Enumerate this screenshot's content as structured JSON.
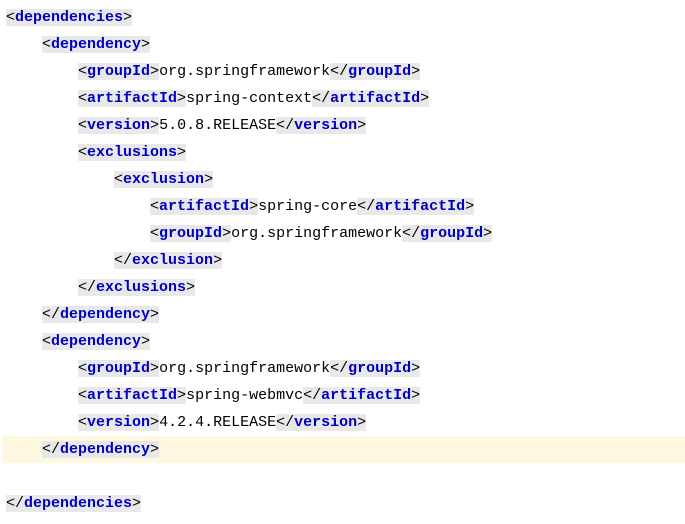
{
  "lines": [
    {
      "indent": 0,
      "parts": [
        {
          "t": "o",
          "v": "dependencies"
        }
      ],
      "sel": false,
      "hl": false
    },
    {
      "indent": 1,
      "parts": [
        {
          "t": "o",
          "v": "dependency"
        }
      ],
      "sel": false,
      "hl": false
    },
    {
      "indent": 2,
      "parts": [
        {
          "t": "o",
          "v": "groupId"
        },
        {
          "t": "x",
          "v": "org.springframework"
        },
        {
          "t": "c",
          "v": "groupId"
        }
      ],
      "sel": false,
      "hl": false
    },
    {
      "indent": 2,
      "parts": [
        {
          "t": "o",
          "v": "artifactId"
        },
        {
          "t": "x",
          "v": "spring-context"
        },
        {
          "t": "c",
          "v": "artifactId"
        }
      ],
      "sel": false,
      "hl": false
    },
    {
      "indent": 2,
      "parts": [
        {
          "t": "o",
          "v": "version"
        },
        {
          "t": "x",
          "v": "5.0.8.RELEASE"
        },
        {
          "t": "c",
          "v": "version"
        }
      ],
      "sel": false,
      "hl": false
    },
    {
      "indent": 2,
      "parts": [
        {
          "t": "o",
          "v": "exclusions"
        }
      ],
      "sel": false,
      "hl": false
    },
    {
      "indent": 3,
      "parts": [
        {
          "t": "o",
          "v": "exclusion"
        }
      ],
      "sel": false,
      "hl": false
    },
    {
      "indent": 4,
      "parts": [
        {
          "t": "o",
          "v": "artifactId"
        },
        {
          "t": "x",
          "v": "spring-core"
        },
        {
          "t": "c",
          "v": "artifactId"
        }
      ],
      "sel": false,
      "hl": false
    },
    {
      "indent": 4,
      "parts": [
        {
          "t": "o",
          "v": "groupId"
        },
        {
          "t": "x",
          "v": "org.springframework"
        },
        {
          "t": "c",
          "v": "groupId"
        }
      ],
      "sel": false,
      "hl": false
    },
    {
      "indent": 3,
      "parts": [
        {
          "t": "c",
          "v": "exclusion"
        }
      ],
      "sel": false,
      "hl": false
    },
    {
      "indent": 2,
      "parts": [
        {
          "t": "c",
          "v": "exclusions"
        }
      ],
      "sel": false,
      "hl": false
    },
    {
      "indent": 1,
      "parts": [
        {
          "t": "c",
          "v": "dependency"
        }
      ],
      "sel": false,
      "hl": false
    },
    {
      "indent": 1,
      "parts": [
        {
          "t": "o",
          "v": "dependency"
        }
      ],
      "sel": true,
      "hl": false
    },
    {
      "indent": 2,
      "parts": [
        {
          "t": "o",
          "v": "groupId"
        },
        {
          "t": "x",
          "v": "org.springframework"
        },
        {
          "t": "c",
          "v": "groupId"
        }
      ],
      "sel": false,
      "hl": false
    },
    {
      "indent": 2,
      "parts": [
        {
          "t": "o",
          "v": "artifactId"
        },
        {
          "t": "x",
          "v": "spring-webmvc"
        },
        {
          "t": "c",
          "v": "artifactId"
        }
      ],
      "sel": false,
      "hl": false
    },
    {
      "indent": 2,
      "parts": [
        {
          "t": "o",
          "v": "version"
        },
        {
          "t": "x",
          "v": "4.2.4.RELEASE"
        },
        {
          "t": "c",
          "v": "version"
        }
      ],
      "sel": false,
      "hl": false
    },
    {
      "indent": 1,
      "parts": [
        {
          "t": "c",
          "v": "dependency"
        }
      ],
      "sel": true,
      "hl": true
    },
    {
      "indent": -1,
      "parts": [],
      "sel": false,
      "hl": false
    },
    {
      "indent": 0,
      "parts": [
        {
          "t": "c",
          "v": "dependencies"
        }
      ],
      "sel": false,
      "hl": false
    }
  ],
  "indent_unit": "    "
}
